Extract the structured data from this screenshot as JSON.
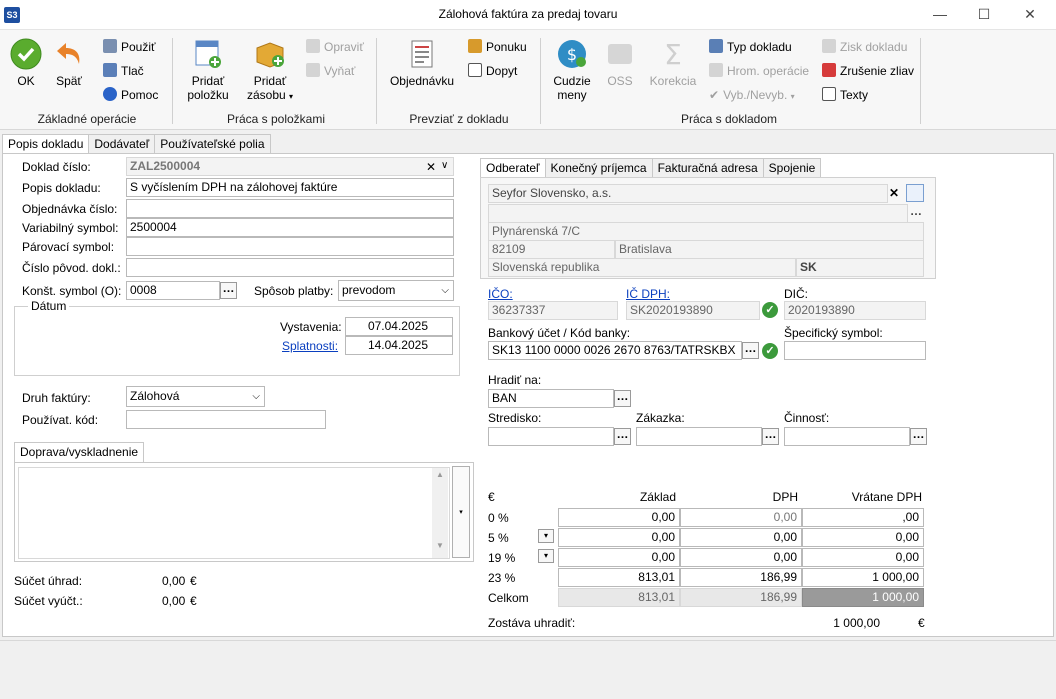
{
  "window": {
    "app_badge": "S3",
    "title": "Zálohová faktúra za predaj tovaru",
    "minimize": "—",
    "maximize": "☐",
    "close": "✕"
  },
  "ribbon": {
    "groups": {
      "basic": "Základné operácie",
      "items": "Práca s položkami",
      "transfer": "Prevziať z dokladu",
      "document": "Práca s dokladom"
    },
    "ok": "OK",
    "back": "Späť",
    "use": "Použiť",
    "print": "Tlač",
    "help": "Pomoc",
    "add_item_1": "Pridať",
    "add_item_2": "položku",
    "add_stock_1": "Pridať",
    "add_stock_2": "zásobu",
    "edit": "Opraviť",
    "remove": "Vyňať",
    "order": "Objednávku",
    "offer": "Ponuku",
    "inquiry": "Dopyt",
    "currency_1": "Cudzie",
    "currency_2": "meny",
    "oss": "OSS",
    "correction": "Korekcia",
    "doc_type": "Typ dokladu",
    "bulk_ops": "Hrom. operácie",
    "select": "Vyb./Nevyb.",
    "profit": "Zisk dokladu",
    "cancel_discounts": "Zrušenie zliav",
    "texts": "Texty"
  },
  "main_tabs": [
    "Popis dokladu",
    "Dodávateľ",
    "Používateľské polia"
  ],
  "left": {
    "doc_number_label": "Doklad číslo:",
    "doc_number": "ZAL2500004",
    "description_label": "Popis dokladu:",
    "description": "S vyčíslením DPH na zálohovej faktúre",
    "order_number_label": "Objednávka číslo:",
    "order_number": "",
    "variable_symbol_label": "Variabilný symbol:",
    "variable_symbol": "2500004",
    "pairing_symbol_label": "Párovací symbol:",
    "pairing_symbol": "",
    "orig_doc_label": "Číslo pôvod. dokl.:",
    "orig_doc": "",
    "const_symbol_label": "Konšt. symbol (O):",
    "const_symbol": "0008",
    "payment_method_label": "Spôsob platby:",
    "payment_method": "prevodom",
    "date_group": "Dátum",
    "issue_label": "Vystavenia:",
    "issue_date": "07.04.2025",
    "due_label": "Splatnosti:",
    "due_date": "14.04.2025",
    "invoice_type_label": "Druh faktúry:",
    "invoice_type": "Zálohová",
    "user_code_label": "Používat. kód:",
    "user_code": "",
    "transport_tab": "Doprava/vyskladnenie",
    "payments_sum_label": "Súčet úhrad:",
    "payments_sum": "0,00",
    "billing_sum_label": "Súčet vyúčt.:",
    "billing_sum": "0,00",
    "currency": "€"
  },
  "right": {
    "tabs": [
      "Odberateľ",
      "Konečný príjemca",
      "Fakturačná adresa",
      "Spojenie"
    ],
    "company": "Seyfor Slovensko, a.s.",
    "street": "Plynárenská 7/C",
    "zip": "82109",
    "city": "Bratislava",
    "country": "Slovenská republika",
    "country_code": "SK",
    "ico_label": "IČO:",
    "ico": "36237337",
    "icdph_label": "IČ DPH:",
    "icdph": "SK2020193890",
    "dic_label": "DIČ:",
    "dic": "2020193890",
    "bank_label": "Bankový účet / Kód banky:",
    "bank": "SK13 1100 0000 0026 2670 8763/TATRSKBX",
    "specific_label": "Špecifický symbol:",
    "specific": "",
    "pay_via_label": "Hradiť na:",
    "pay_via": "BAN",
    "center_label": "Stredisko:",
    "contract_label": "Zákazka:",
    "activity_label": "Činnosť:",
    "vat_table": {
      "currency": "€",
      "headers": [
        "Základ",
        "DPH",
        "Vrátane DPH"
      ],
      "rows": [
        {
          "rate": "0 %",
          "base": "0,00",
          "vat": "0,00",
          "total": ",00"
        },
        {
          "rate": "5 %",
          "base": "0,00",
          "vat": "0,00",
          "total": "0,00"
        },
        {
          "rate": "19 %",
          "base": "0,00",
          "vat": "0,00",
          "total": "0,00"
        },
        {
          "rate": "23 %",
          "base": "813,01",
          "vat": "186,99",
          "total": "1 000,00"
        }
      ],
      "total_label": "Celkom",
      "total_base": "813,01",
      "total_vat": "186,99",
      "total_total": "1 000,00"
    },
    "remaining_label": "Zostáva uhradiť:",
    "remaining": "1 000,00",
    "remaining_currency": "€"
  }
}
